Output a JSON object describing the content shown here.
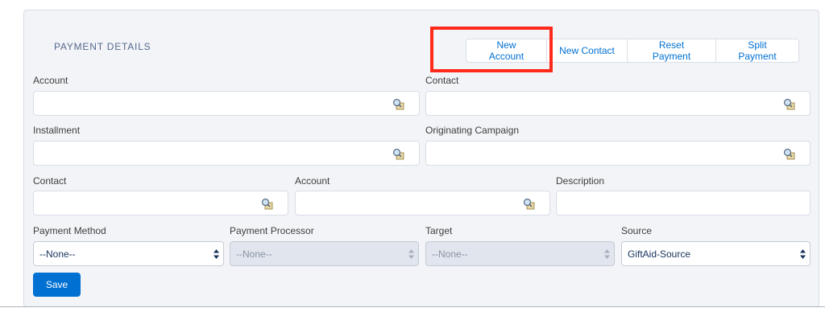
{
  "section": {
    "title": "PAYMENT DETAILS"
  },
  "toolbar": {
    "new_account": "New Account",
    "new_contact": "New Contact",
    "reset_payment": "Reset Payment",
    "split_payment": "Split Payment"
  },
  "fields": {
    "account": {
      "label": "Account",
      "value": ""
    },
    "contact": {
      "label": "Contact",
      "value": ""
    },
    "installment": {
      "label": "Installment",
      "value": ""
    },
    "originating_campaign": {
      "label": "Originating Campaign",
      "value": ""
    },
    "contact2": {
      "label": "Contact",
      "value": ""
    },
    "account2": {
      "label": "Account",
      "value": ""
    },
    "description": {
      "label": "Description",
      "value": ""
    },
    "payment_method": {
      "label": "Payment Method",
      "value": "--None--"
    },
    "payment_processor": {
      "label": "Payment Processor",
      "value": "--None--"
    },
    "target": {
      "label": "Target",
      "value": "--None--"
    },
    "source": {
      "label": "Source",
      "value": "GiftAid-Source"
    }
  },
  "actions": {
    "save": "Save"
  },
  "colors": {
    "accent": "#0070d2",
    "highlight": "#ff2a1a"
  },
  "icons": {
    "lookup": "magnifier-lookup-icon",
    "select": "select-arrows-icon"
  }
}
